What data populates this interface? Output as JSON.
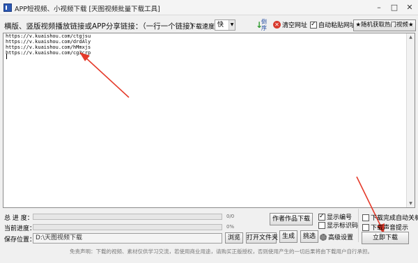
{
  "window": {
    "title": "APP短视频、小视频下载 [天图视频批量下载工具]",
    "controls": [
      "–",
      "□",
      "✕"
    ]
  },
  "toolbar": {
    "instruction": "横版、竖版视频播放链接或APP分享链接：（一行一个链接）",
    "speed_label": "下载速度：",
    "speed_value": "快",
    "sort_label": "倒序",
    "clear_label": "清空网址",
    "autopaste_label": "自动粘贴网址",
    "autopaste_checked": true,
    "hot_button_label": "★随机获取热门视频★"
  },
  "links": [
    "https://v.kuaishou.com/ctgjsu",
    "https://v.kuaishou.com/drdAly",
    "https://v.kuaishou.com/hMmxjs",
    "https://v.kuaishou.com/cg3crp"
  ],
  "progress": {
    "total_label": "总 进 度：",
    "total_fraction": "0/0",
    "total_percent": 0,
    "current_label": "当前进度：",
    "current_percent_text": "0%",
    "current_percent": 0
  },
  "save": {
    "label": "保存位置：",
    "path": "D:\\天图视频下载",
    "browse_label": "浏览",
    "open_folder_label": "打开文件夹"
  },
  "actions": {
    "author_download_label": "作者作品下载",
    "generate_label": "生成",
    "filter_label": "挑选",
    "advanced_label": "高级设置",
    "download_now_label": "立即下载"
  },
  "options": {
    "show_number_label": "显示编号",
    "show_number_checked": true,
    "show_id_label": "显示标识码",
    "show_id_checked": false,
    "auto_shutdown_label": "下载完成自动关机",
    "auto_shutdown_checked": false,
    "sound_prompt_label": "下载声音提示",
    "sound_prompt_checked": false
  },
  "footer": {
    "disclaimer": "免责声明：下载的视频、素材仅供学习交流，若使用商业用途，请购买正版授权，否则使用产生的一切后果将由下载用户自行承担。"
  },
  "colors": {
    "annotation_arrow": "#e53a2a",
    "progress_fill": "#3b8ee0",
    "clear_icon": "#d83a2e",
    "sort_arrow": "#2e9a2e"
  }
}
